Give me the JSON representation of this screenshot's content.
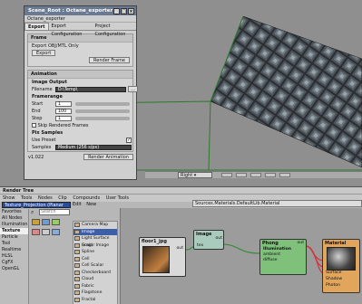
{
  "exporter": {
    "window_title": "Scene_Root : Octane_exporter",
    "subtitle": "Octane_exporter",
    "tabs": [
      "Export",
      "Export Configuration",
      "Project Configuration"
    ],
    "frame_group": "Frame",
    "export_label": "Export OBJ/MTL Only",
    "export_button": "Export",
    "render_frame_button": "Render Frame",
    "animation_group": "Animation",
    "image_output_group": "Image Output",
    "filename_label": "Filename",
    "filename_value": "D:\\Temp\\",
    "framerange_group": "Framerange",
    "start_label": "Start",
    "start_value": "1",
    "end_label": "End",
    "end_value": "100",
    "step_label": "Step",
    "step_value": "1",
    "skip_label": "Skip Rendered Frames",
    "pix_samples_group": "Pix Samples",
    "use_preset_label": "Use Preset",
    "samples_label": "Samples",
    "samples_value": "Medium (256 s/px)",
    "version": "v1.022",
    "render_animation_button": "Render Animation"
  },
  "viewbar": {
    "camera": "Right"
  },
  "render_tree": {
    "title": "Render Tree",
    "menu": [
      "Show",
      "Tools",
      "Nodes",
      "Clip",
      "Compounds",
      "User Tools"
    ],
    "selector": "Texture_Projection (Planar XZ)",
    "edit_label": "Edit",
    "new_label": "New",
    "breadcrumb": "Sources.Materials.DefaultLib.Material",
    "search_placeholder": "Search",
    "categories": [
      "Favorites",
      "All Nodes",
      "Illumination",
      "Texture",
      "Particle",
      "Tool",
      "Realtime",
      "HLSL",
      "CgFX",
      "OpenGL"
    ],
    "selected_category": "Texture",
    "node_list": [
      "Camera Map (img)",
      "Image",
      "Light Surface (img)",
      "Scalar Image",
      "Spline",
      "Cell",
      "Cell Scalar",
      "Checkerboard",
      "Cloud",
      "Fabric",
      "Flagstone",
      "Fractal"
    ],
    "selected_node": "Image",
    "nodes": {
      "floor": {
        "title": "floor1_jpg",
        "port": "out"
      },
      "image": {
        "title": "Image",
        "port_in": "tex",
        "port_out": "out"
      },
      "phong": {
        "title": "Phong",
        "port_out": "out",
        "section": "Illumination",
        "ports": [
          "ambient",
          "diffuse"
        ]
      },
      "material": {
        "title": "Material",
        "ports": [
          "Surface",
          "Shadow",
          "Photon"
        ]
      }
    }
  },
  "colors": {
    "selection_blue": "#3c5fa8",
    "phong_green": "#7fc07a",
    "material_orange": "#e2a55c",
    "image_node_teal": "#a9cbbd",
    "connection_red": "#d0343c",
    "connection_green": "#3c8a3c"
  }
}
